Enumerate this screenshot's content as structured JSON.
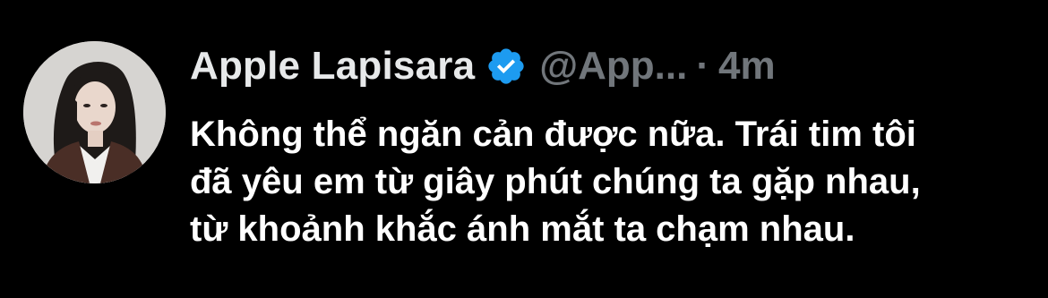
{
  "tweet": {
    "author": {
      "display_name": "Apple Lapisara",
      "handle": "@App...",
      "verified": true,
      "verified_icon": "verified-badge-icon",
      "verified_color": "#1d9bf0"
    },
    "separator": "·",
    "timestamp": "4m",
    "text": "Không thể ngăn cản được nữa. Trái tim tôi\nđã yêu em từ giây phút chúng ta gặp nhau,\ntừ khoảnh khắc ánh mắt ta chạm nhau."
  },
  "colors": {
    "background": "#000000",
    "name": "#e7e9ea",
    "muted": "#71767b",
    "text": "#ffffff"
  }
}
